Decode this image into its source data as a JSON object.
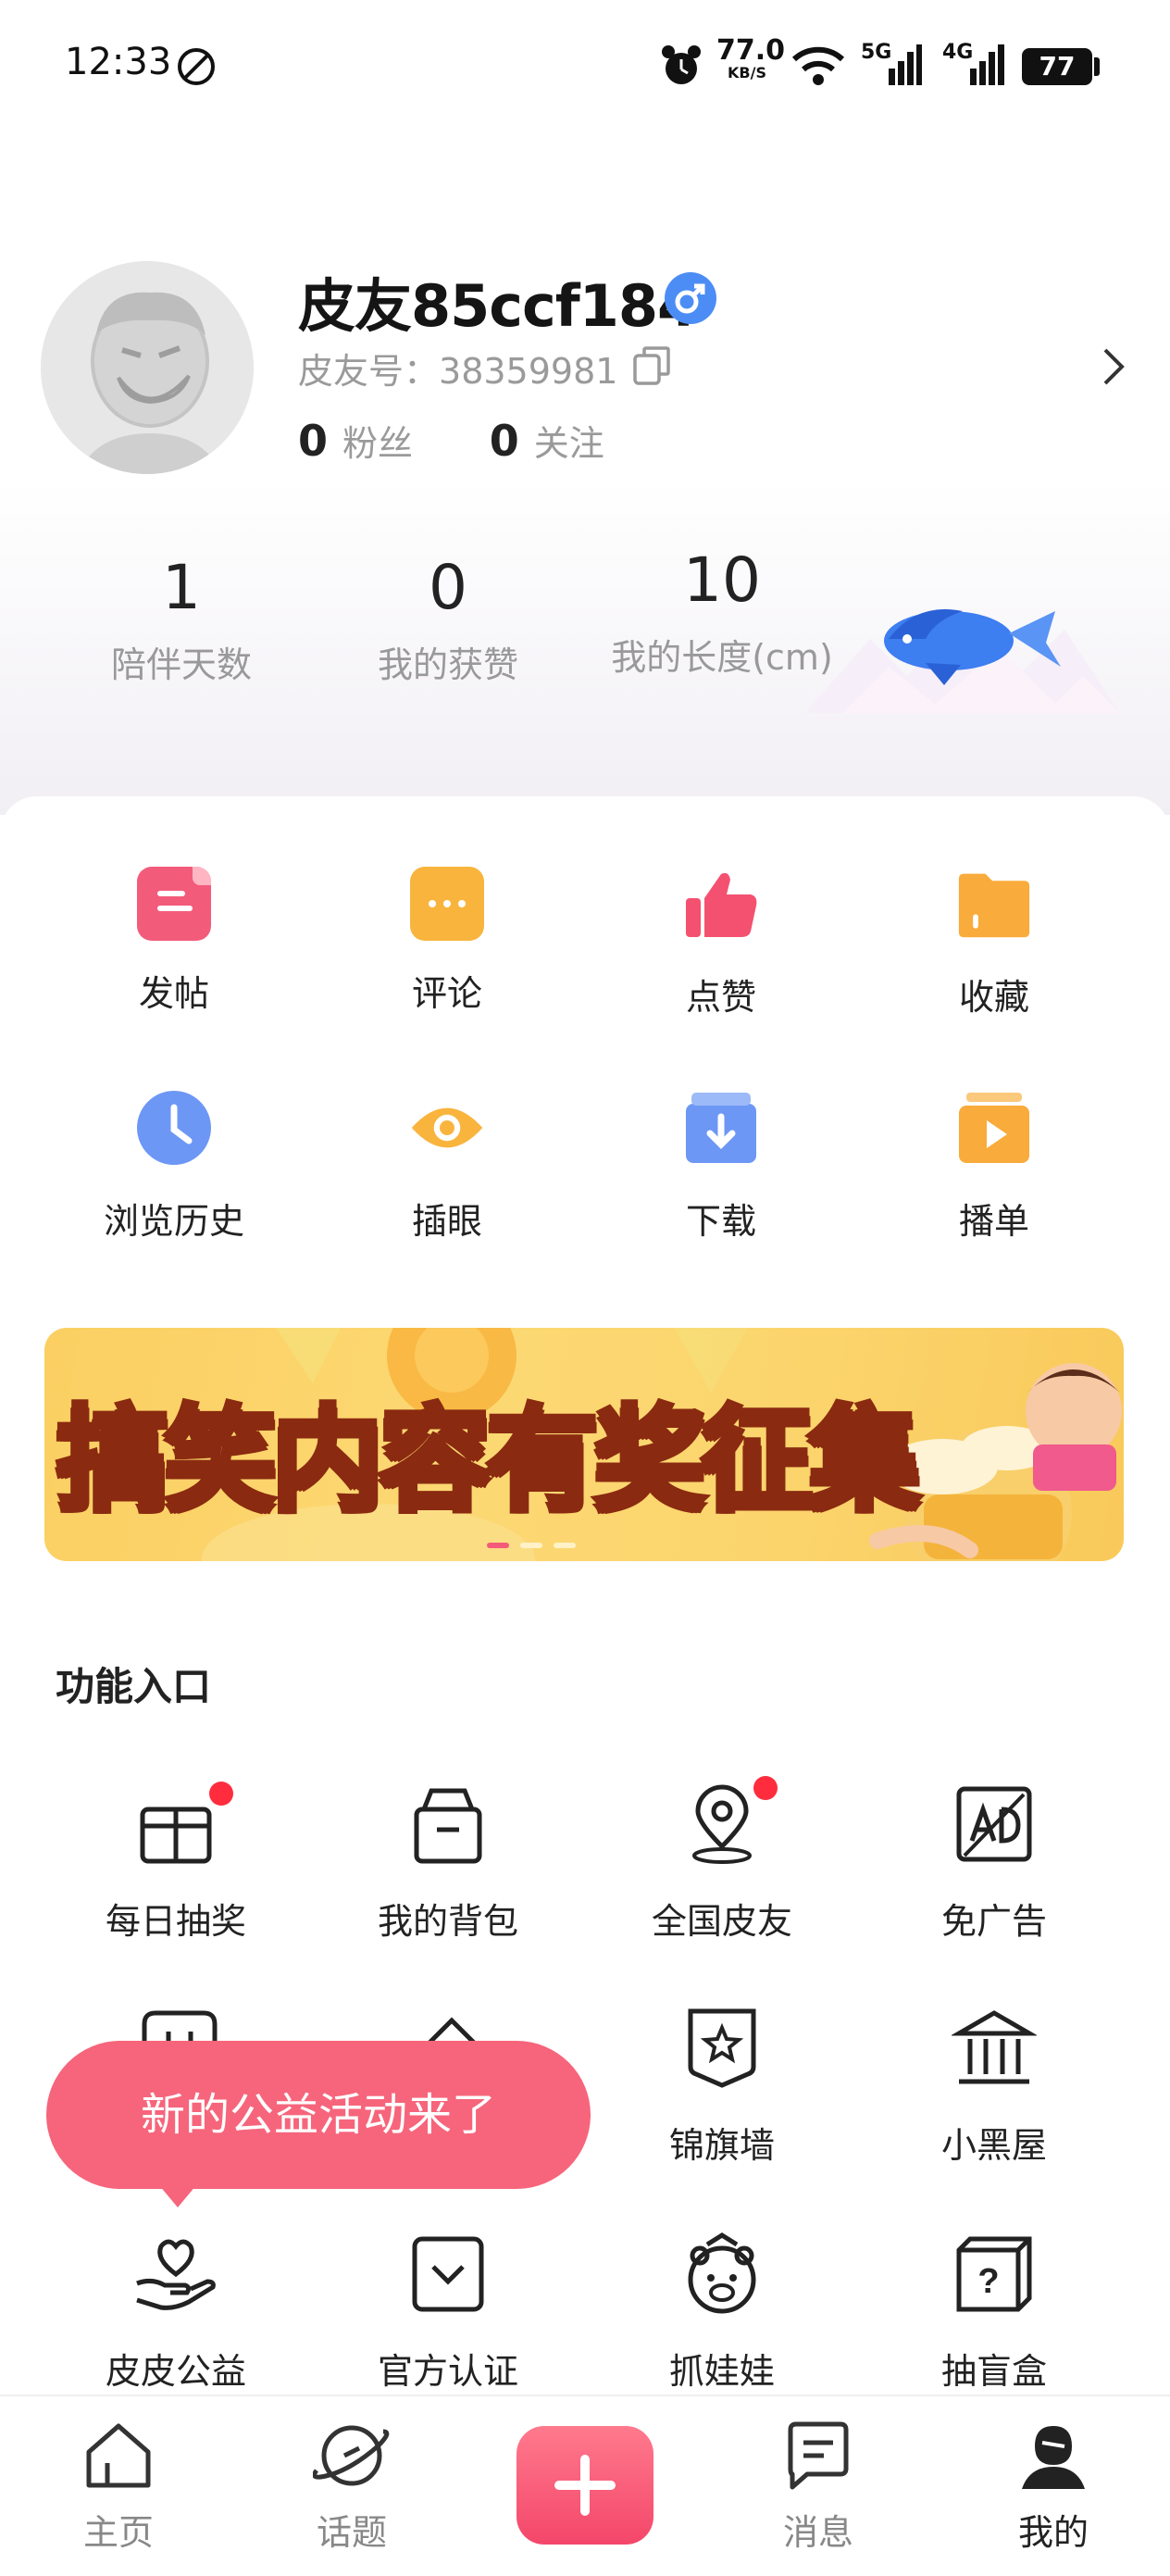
{
  "status_bar": {
    "time": "12:33",
    "net_speed_value": "77.0",
    "net_speed_unit": "KB/S",
    "signal1_label": "5G",
    "signal2_label": "4G",
    "battery": "77"
  },
  "profile": {
    "username": "皮友85ccf184",
    "id_label": "皮友号：",
    "id_value": "38359981",
    "fans_count": "0",
    "fans_label": "粉丝",
    "follow_count": "0",
    "follow_label": "关注"
  },
  "stats": [
    {
      "value": "1",
      "label": "陪伴天数"
    },
    {
      "value": "0",
      "label": "我的获赞"
    },
    {
      "value": "10",
      "label": "我的长度(cm)"
    }
  ],
  "quick_actions": [
    {
      "label": "发帖",
      "icon": "post-icon",
      "color": "#f35b7b"
    },
    {
      "label": "评论",
      "icon": "comment-icon",
      "color": "#f9b43d"
    },
    {
      "label": "点赞",
      "icon": "thumbs-up-icon",
      "color": "#f45171"
    },
    {
      "label": "收藏",
      "icon": "folder-icon",
      "color": "#f9ab3b"
    },
    {
      "label": "浏览历史",
      "icon": "clock-icon",
      "color": "#6d97f5"
    },
    {
      "label": "插眼",
      "icon": "eye-icon",
      "color": "#f9b43d"
    },
    {
      "label": "下载",
      "icon": "download-icon",
      "color": "#6d97f5"
    },
    {
      "label": "播单",
      "icon": "playlist-icon",
      "color": "#f9ab3b"
    }
  ],
  "banner": {
    "title": "搞笑内容有奖征集"
  },
  "functions": {
    "title": "功能入口",
    "items": [
      {
        "label": "每日抽奖",
        "icon": "gift-icon"
      },
      {
        "label": "我的背包",
        "icon": "backpack-icon"
      },
      {
        "label": "全国皮友",
        "icon": "location-pin-icon"
      },
      {
        "label": "免广告",
        "icon": "no-ads-icon"
      },
      {
        "label": "锦旗墙",
        "icon": "banner-star-icon"
      },
      {
        "label": "小黑屋",
        "icon": "courthouse-icon"
      },
      {
        "label": "皮皮公益",
        "icon": "hand-heart-icon"
      },
      {
        "label": "官方认证",
        "icon": "verified-check-icon"
      },
      {
        "label": "抓娃娃",
        "icon": "claw-doll-icon"
      },
      {
        "label": "抽盲盒",
        "icon": "blind-box-icon"
      }
    ]
  },
  "tooltip": {
    "text": "新的公益活动来了"
  },
  "bottom_nav": [
    {
      "label": "主页",
      "icon": "home-icon"
    },
    {
      "label": "话题",
      "icon": "planet-icon"
    },
    {
      "label": "",
      "icon": "plus-icon"
    },
    {
      "label": "消息",
      "icon": "message-icon"
    },
    {
      "label": "我的",
      "icon": "profile-icon"
    }
  ],
  "colors": {
    "accent_pink": "#f35b7b",
    "verified_blue": "#4c8df5",
    "notification_red": "#ff2c3e"
  }
}
